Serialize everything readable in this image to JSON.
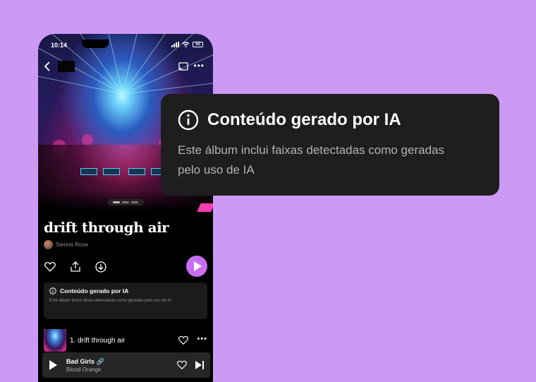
{
  "status_bar": {
    "time": "10:14",
    "battery": "55"
  },
  "album": {
    "title": "drift through air",
    "artist": "Sienna Rose"
  },
  "notice": {
    "title": "Conteúdo gerado por IA",
    "body_large": "Este álbum inclui faixas detectadas como geradas pelo uso de IA",
    "body_small": "Este álbum inclui faixas detectadas como geradas pelo uso de IA"
  },
  "tracks": [
    {
      "title": "1. drift through air"
    }
  ],
  "now_playing": {
    "title": "Bad Girls 🔗",
    "artist": "Blood Orange"
  },
  "icons": {
    "info": "info-icon",
    "back": "chevron-left-icon",
    "cast": "cast-icon",
    "like": "heart-icon",
    "share": "share-icon",
    "download": "download-icon",
    "play": "play-icon",
    "next": "skip-next-icon",
    "more": "more-icon"
  },
  "colors": {
    "background": "#cc99f5",
    "accent": "#c76ff0",
    "tooltip_bg": "#1e1e1e"
  }
}
